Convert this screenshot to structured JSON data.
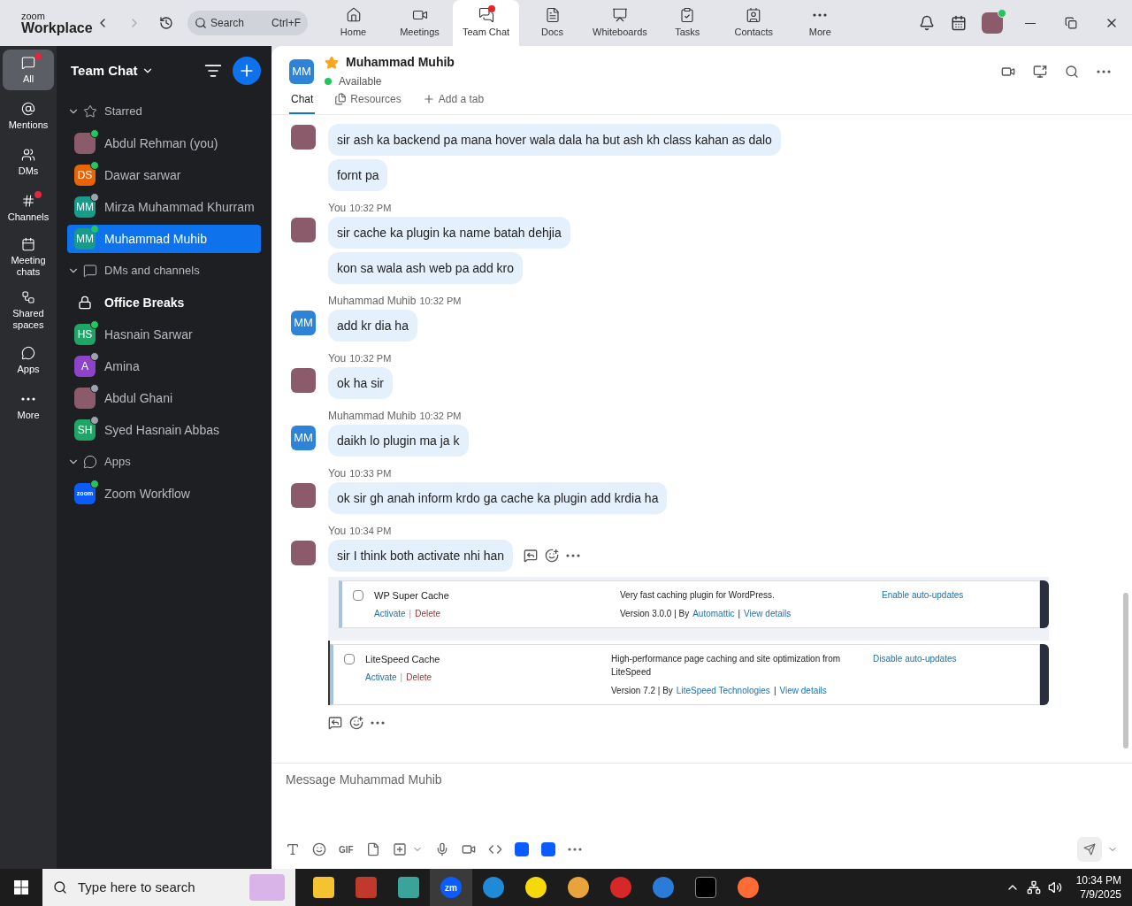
{
  "app": {
    "logo_top": "zoom",
    "logo_bottom": "Workplace",
    "search": {
      "placeholder": "Search",
      "shortcut": "Ctrl+F"
    }
  },
  "nav_tabs": [
    {
      "label": "Home",
      "selected": false,
      "badge": false
    },
    {
      "label": "Meetings",
      "selected": false,
      "badge": false
    },
    {
      "label": "Team Chat",
      "selected": true,
      "badge": true
    },
    {
      "label": "Docs",
      "selected": false,
      "badge": false
    },
    {
      "label": "Whiteboards",
      "selected": false,
      "badge": false
    },
    {
      "label": "Tasks",
      "selected": false,
      "badge": false
    },
    {
      "label": "Contacts",
      "selected": false,
      "badge": false
    },
    {
      "label": "More",
      "selected": false,
      "badge": false
    }
  ],
  "profile": {
    "online": true
  },
  "rail": [
    {
      "label": "All",
      "selected": true,
      "badge": true
    },
    {
      "label": "Mentions",
      "selected": false,
      "badge": false
    },
    {
      "label": "DMs",
      "selected": false,
      "badge": false
    },
    {
      "label": "Channels",
      "selected": false,
      "badge": true
    },
    {
      "label": "Meeting chats",
      "selected": false,
      "badge": false
    },
    {
      "label": "Shared spaces",
      "selected": false,
      "badge": false
    },
    {
      "label": "Apps",
      "selected": false,
      "badge": false
    },
    {
      "label": "More",
      "selected": false,
      "badge": false
    }
  ],
  "sidebar": {
    "title": "Team Chat",
    "sections": [
      {
        "label": "Starred",
        "expanded": true,
        "items": [
          {
            "kind": "photo",
            "name": "Abdul Rehman (you)",
            "online": true,
            "selected": false,
            "bold": false
          },
          {
            "kind": "initials",
            "initials": "DS",
            "color": "#e8630a",
            "name": "Dawar sarwar",
            "online": true,
            "selected": false,
            "bold": false
          },
          {
            "kind": "initials",
            "initials": "MM",
            "color": "#1a9b8a",
            "name": "Mirza Muhammad Khurram",
            "online": false,
            "selected": false,
            "bold": false
          },
          {
            "kind": "initials",
            "initials": "MM",
            "color": "#1a9b8a",
            "name": "Muhammad Muhib",
            "online": true,
            "selected": true,
            "bold": false
          }
        ]
      },
      {
        "label": "DMs and channels",
        "expanded": true,
        "items": [
          {
            "kind": "lock",
            "name": "Office Breaks",
            "selected": false,
            "bold": true
          },
          {
            "kind": "initials",
            "initials": "HS",
            "color": "#21a566",
            "name": "Hasnain Sarwar",
            "online": true,
            "selected": false,
            "bold": false
          },
          {
            "kind": "initials",
            "initials": "A",
            "color": "#8e44c9",
            "name": "Amina",
            "online": false,
            "selected": false,
            "bold": false
          },
          {
            "kind": "photo",
            "name": "Abdul Ghani",
            "online": false,
            "selected": false,
            "bold": false
          },
          {
            "kind": "initials",
            "initials": "SH",
            "color": "#21a566",
            "name": "Syed Hasnain Abbas",
            "online": false,
            "selected": false,
            "bold": false
          }
        ]
      },
      {
        "label": "Apps",
        "expanded": true,
        "items": [
          {
            "kind": "app",
            "initials": "zoom",
            "color": "#0b5cff",
            "name": "Zoom Workflow",
            "online": true,
            "selected": false,
            "bold": false
          }
        ]
      }
    ]
  },
  "chat": {
    "initials": "MM",
    "name": "Muhammad Muhib",
    "starred": true,
    "status": "Available",
    "online": true,
    "tabs": [
      {
        "label": "Chat",
        "selected": true
      },
      {
        "label": "Resources",
        "selected": false
      },
      {
        "label": "Add a tab",
        "selected": false
      }
    ],
    "messages": [
      {
        "kind": "mine",
        "bubbles": [
          "sir ash ka backend pa mana hover wala dala ha but ash kh class kahan as dalo",
          "fornt pa"
        ]
      },
      {
        "kind": "mine",
        "sender": "You",
        "time": "10:32 PM",
        "bubbles": [
          "sir cache ka plugin ka name batah dehjia",
          "kon sa wala ash web pa add kro"
        ]
      },
      {
        "kind": "theirs",
        "initials": "MM",
        "sender": "Muhammad Muhib",
        "time": "10:32 PM",
        "bubbles": [
          "add kr dia ha"
        ]
      },
      {
        "kind": "mine",
        "sender": "You",
        "time": "10:32 PM",
        "bubbles": [
          "ok ha sir"
        ]
      },
      {
        "kind": "theirs",
        "initials": "MM",
        "sender": "Muhammad Muhib",
        "time": "10:32 PM",
        "bubbles": [
          "daikh lo plugin ma ja k"
        ]
      },
      {
        "kind": "mine",
        "sender": "You",
        "time": "10:33 PM",
        "bubbles": [
          "ok sir gh anah inform krdo ga cache ka plugin add krdia ha"
        ]
      },
      {
        "kind": "mine",
        "sender": "You",
        "time": "10:34 PM",
        "hovered": true,
        "bubbles": [
          "sir I think both activate nhi han"
        ],
        "attachment": [
          {
            "name": "WP Super Cache",
            "checked": false,
            "activate": "Activate",
            "separator": "|",
            "delete": "Delete",
            "description": "Very fast caching plugin for WordPress.",
            "version": "Version 3.0.0 | By",
            "author": "Automattic",
            "separator2": "|",
            "details": "View details",
            "auto_update": "Enable auto-updates"
          },
          {
            "name": "LiteSpeed Cache",
            "checked": false,
            "activate": "Activate",
            "separator": "|",
            "delete": "Delete",
            "description": "High-performance page caching and site optimization from LiteSpeed",
            "version": "Version 7.2 | By",
            "author": "LiteSpeed Technologies",
            "separator2": "|",
            "details": "View details",
            "auto_update": "Disable auto-updates"
          }
        ]
      }
    ]
  },
  "composer": {
    "placeholder": "Message Muhammad Muhib",
    "gif": "GIF"
  },
  "taskbar": {
    "search_placeholder": "Type here to search",
    "app_logo": "zm",
    "time": "10:34 PM",
    "date": "7/9/2025"
  }
}
